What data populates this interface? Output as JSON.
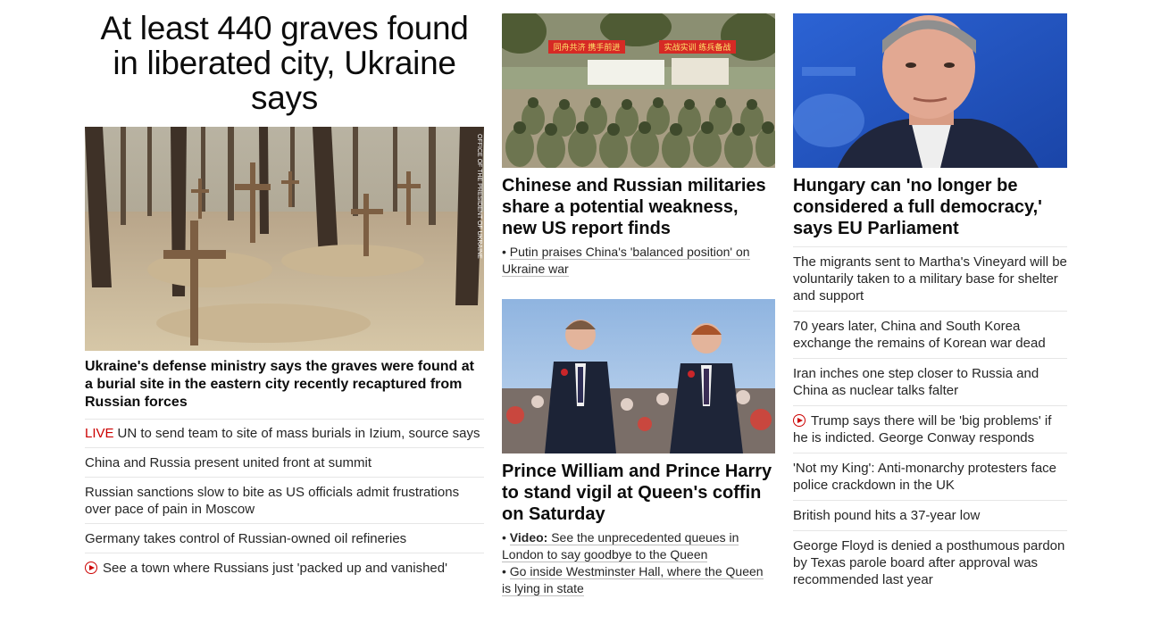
{
  "col1": {
    "headline": "At least 440 graves found in liberated city, Ukraine says",
    "photo_credit": "OFFICE OF THE PRESIDENT OF UKRAINE",
    "subhead": "Ukraine's defense ministry says the graves were found at a burial site in the eastern city recently recaptured from Russian forces",
    "items": [
      {
        "tag": "LIVE",
        "text": "UN to send team to site of mass burials in Izium, source says"
      },
      {
        "text": "China and Russia present united front at summit"
      },
      {
        "text": "Russian sanctions slow to bite as US officials admit frustrations over pace of pain in Moscow"
      },
      {
        "text": "Germany takes control of Russian-owned oil refineries"
      },
      {
        "video": true,
        "text": "See a town where Russians just 'packed up and vanished'"
      }
    ]
  },
  "col2": {
    "story1": {
      "title": "Chinese and Russian militaries share a potential weakness, new US report finds",
      "bullet": "Putin praises China's 'balanced position' on Ukraine war",
      "banner_left": "同舟共济 携手前进",
      "banner_right": "实战实训 练兵备战"
    },
    "story2": {
      "title": "Prince William and Prince Harry to stand vigil at Queen's coffin on Saturday",
      "bullet1_label": "Video:",
      "bullet1_text": "See the unprecedented queues in London to say goodbye to the Queen",
      "bullet2_text": "Go inside Westminster Hall, where the Queen is lying in state"
    }
  },
  "col3": {
    "title": "Hungary can 'no longer be considered a full democracy,' says EU Parliament",
    "items": [
      {
        "text": "The migrants sent to Martha's Vineyard will be voluntarily taken to a military base for shelter and support"
      },
      {
        "text": "70 years later, China and South Korea exchange the remains of Korean war dead"
      },
      {
        "text": "Iran inches one step closer to Russia and China as nuclear talks falter"
      },
      {
        "video": true,
        "text": "Trump says there will be 'big problems' if he is indicted. George Conway responds"
      },
      {
        "text": "'Not my King': Anti-monarchy protesters face police crackdown in the UK"
      },
      {
        "text": "British pound hits a 37-year low"
      },
      {
        "text": "George Floyd is denied a posthumous pardon by Texas parole board after approval was recommended last year"
      }
    ]
  },
  "colors": {
    "live": "#cc0000",
    "text": "#0c0c0c",
    "divider": "#e6e6e6"
  },
  "icons": [
    "play-circle-icon"
  ]
}
